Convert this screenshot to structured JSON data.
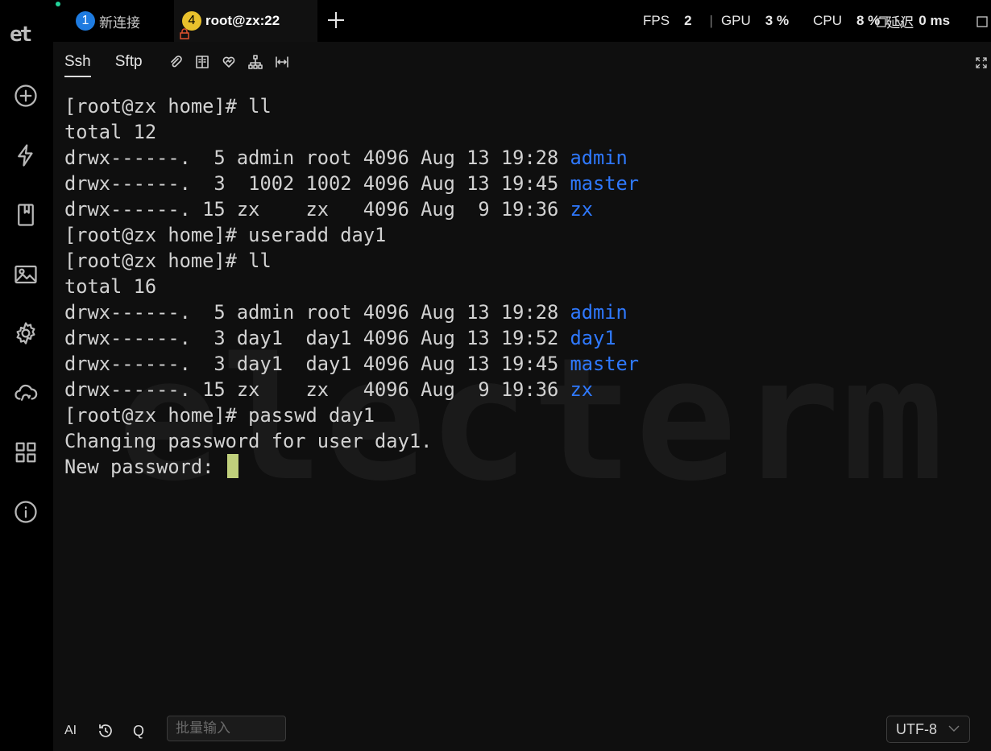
{
  "app": {
    "logo_text": "et"
  },
  "sidebar": {
    "icons": [
      "add-circle-icon",
      "lightning-icon",
      "bookmark-icon",
      "image-icon",
      "gear-icon",
      "cloud-sync-icon",
      "grid-icon",
      "info-icon"
    ]
  },
  "tabs": [
    {
      "number": "1",
      "label": "新连接",
      "active": false
    },
    {
      "number": "4",
      "label": "root@zx:22",
      "active": true
    }
  ],
  "stats": {
    "fps_label": "FPS",
    "fps_value": "2",
    "gpu_label": "GPU",
    "gpu_value": "3 %",
    "cpu_label": "CPU",
    "cpu_value": "8 %",
    "latency_label": "延迟",
    "latency_value": "0 ms"
  },
  "subtabs": [
    {
      "label": "Ssh"
    },
    {
      "label": "Sftp"
    }
  ],
  "watermark": "electerm",
  "terminal": {
    "prompt": "[root@zx home]# ",
    "lines": [
      {
        "text": "[root@zx home]# ll"
      },
      {
        "text": "total 12"
      },
      {
        "text": "drwx------.  5 admin root 4096 Aug 13 19:28 ",
        "dir": "admin"
      },
      {
        "text": "drwx------.  3  1002 1002 4096 Aug 13 19:45 ",
        "dir": "master"
      },
      {
        "text": "drwx------. 15 zx    zx   4096 Aug  9 19:36 ",
        "dir": "zx"
      },
      {
        "text": "[root@zx home]# useradd day1"
      },
      {
        "text": "[root@zx home]# ll"
      },
      {
        "text": "total 16"
      },
      {
        "text": "drwx------.  5 admin root 4096 Aug 13 19:28 ",
        "dir": "admin"
      },
      {
        "text": "drwx------.  3 day1  day1 4096 Aug 13 19:52 ",
        "dir": "day1"
      },
      {
        "text": "drwx------.  3 day1  day1 4096 Aug 13 19:45 ",
        "dir": "master"
      },
      {
        "text": "drwx------. 15 zx    zx   4096 Aug  9 19:36 ",
        "dir": "zx"
      },
      {
        "text": "[root@zx home]# passwd day1"
      },
      {
        "text": "Changing password for user day1."
      },
      {
        "text": "New password: ",
        "cursor": true
      }
    ]
  },
  "bottom": {
    "ai_label": "AI",
    "q_label": "Q",
    "batch_placeholder": "批量输入",
    "encoding": "UTF-8"
  },
  "colors": {
    "dir": "#2f79ff",
    "cursor": "#c0d07c",
    "tab1_badge": "#1e7be0",
    "tab2_badge": "#e9c12c",
    "status_dot": "#22d39a"
  }
}
